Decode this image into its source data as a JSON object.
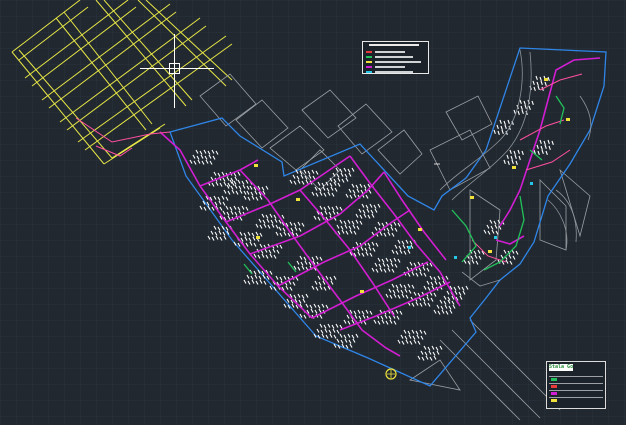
{
  "viewport": {
    "background_color": "#212830",
    "grid_color": "#2c3540"
  },
  "colors": {
    "grid_roads": "#e6e646",
    "parcels": "#ffffff",
    "outer_parcels": "#9a9fa5",
    "boundary": "#2f86e8",
    "network_main": "#d21ed2",
    "network_secondary": "#ff4fa0",
    "network_green": "#22c25a",
    "network_yellow": "#f0e23a",
    "network_cyan": "#24c8e6",
    "network_red": "#e83a3a"
  },
  "legend": {
    "entries": [
      {
        "color": "#e83a3a"
      },
      {
        "color": "#22c25a"
      },
      {
        "color": "#f0e23a"
      },
      {
        "color": "#d21ed2"
      },
      {
        "color": "#24c8e6"
      }
    ]
  },
  "title_block": {
    "logo_text": "Stala Go",
    "rows": [
      {
        "color": "#22c25a"
      },
      {
        "color": "#e83a3a"
      },
      {
        "color": "#d21ed2"
      },
      {
        "color": "#f0e23a"
      }
    ]
  },
  "cursor": {
    "icon": "crosshair-cursor-icon"
  }
}
